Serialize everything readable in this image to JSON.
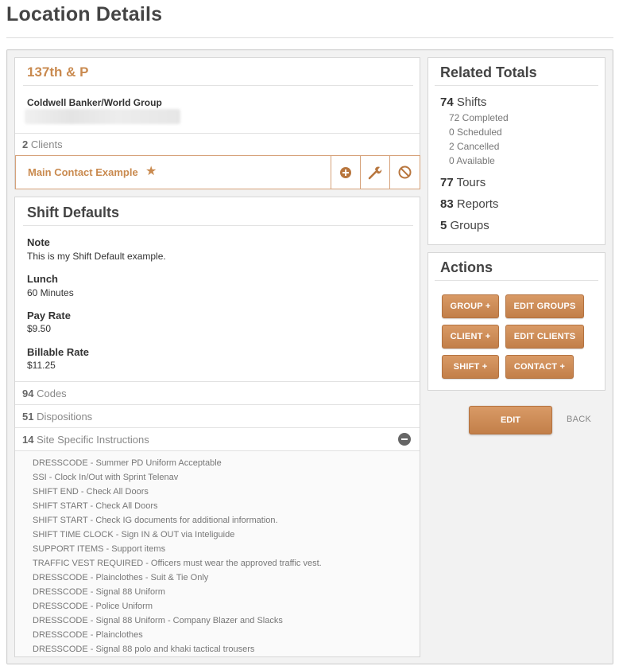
{
  "page": {
    "title": "Location Details"
  },
  "location": {
    "name": "137th & P",
    "company": "Coldwell Banker/World Group",
    "clients_count": "2",
    "clients_label": "Clients",
    "main_contact": "Main Contact Example"
  },
  "shift_defaults": {
    "title": "Shift Defaults",
    "note_label": "Note",
    "note_value": "This is my Shift Default example.",
    "lunch_label": "Lunch",
    "lunch_value": "60 Minutes",
    "pay_rate_label": "Pay Rate",
    "pay_rate_value": "$9.50",
    "billable_rate_label": "Billable Rate",
    "billable_rate_value": "$11.25",
    "codes_count": "94",
    "codes_label": "Codes",
    "dispositions_count": "51",
    "dispositions_label": "Dispositions",
    "instructions_count": "14",
    "instructions_label": "Site Specific Instructions",
    "instructions": [
      "DRESSCODE - Summer PD Uniform Acceptable",
      "SSI - Clock In/Out with Sprint Telenav",
      "SHIFT END - Check All Doors",
      "SHIFT START - Check All Doors",
      "SHIFT START - Check IG documents for additional information.",
      "SHIFT TIME CLOCK - Sign IN & OUT via Inteliguide",
      "SUPPORT ITEMS - Support items",
      "TRAFFIC VEST REQUIRED - Officers must wear the approved traffic vest.",
      "DRESSCODE - Plainclothes - Suit & Tie Only",
      "DRESSCODE - Signal 88 Uniform",
      "DRESSCODE - Police Uniform",
      "DRESSCODE - Signal 88 Uniform - Company Blazer and Slacks",
      "DRESSCODE - Plainclothes",
      "DRESSCODE - Signal 88 polo and khaki tactical trousers"
    ]
  },
  "related_totals": {
    "title": "Related Totals",
    "shifts_count": "74",
    "shifts_label": "Shifts",
    "completed": "72 Completed",
    "scheduled": "0 Scheduled",
    "cancelled": "2 Cancelled",
    "available": "0 Available",
    "tours_count": "77",
    "tours_label": "Tours",
    "reports_count": "83",
    "reports_label": "Reports",
    "groups_count": "5",
    "groups_label": "Groups"
  },
  "actions": {
    "title": "Actions",
    "group_add": "GROUP +",
    "edit_groups": "EDIT GROUPS",
    "client_add": "CLIENT +",
    "edit_clients": "EDIT CLIENTS",
    "shift_add": "SHIFT +",
    "contact_add": "CONTACT +"
  },
  "footer": {
    "edit": "EDIT",
    "back": "BACK"
  },
  "icons": {
    "star": "star-icon",
    "add": "plus-circle-icon",
    "edit": "wrench-icon",
    "remove": "block-icon",
    "collapse": "minus-circle-icon"
  },
  "colors": {
    "accent": "#c98a4f",
    "button": "#c27f49"
  }
}
